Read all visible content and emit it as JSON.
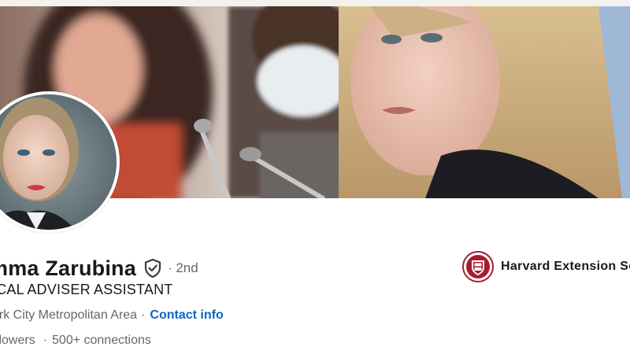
{
  "profile": {
    "name": "mma Zarubina",
    "degree": "· 2nd",
    "headline": "ICAL ADVISER ASSISTANT",
    "location": "ork City Metropolitan Area",
    "location_separator": "·",
    "contact_info": "Contact info",
    "followers": "ollowers",
    "connections_separator": "·",
    "connections": "500+ connections"
  },
  "education": {
    "school_name": "Harvard Extension Sc"
  },
  "icons": {
    "verified": "shield-check-icon",
    "school_logo": "harvard-crest-icon"
  },
  "colors": {
    "link": "#0a66c2",
    "secondary_text": "#666666",
    "primary_text": "#191919",
    "crest_red": "#a51c30"
  }
}
